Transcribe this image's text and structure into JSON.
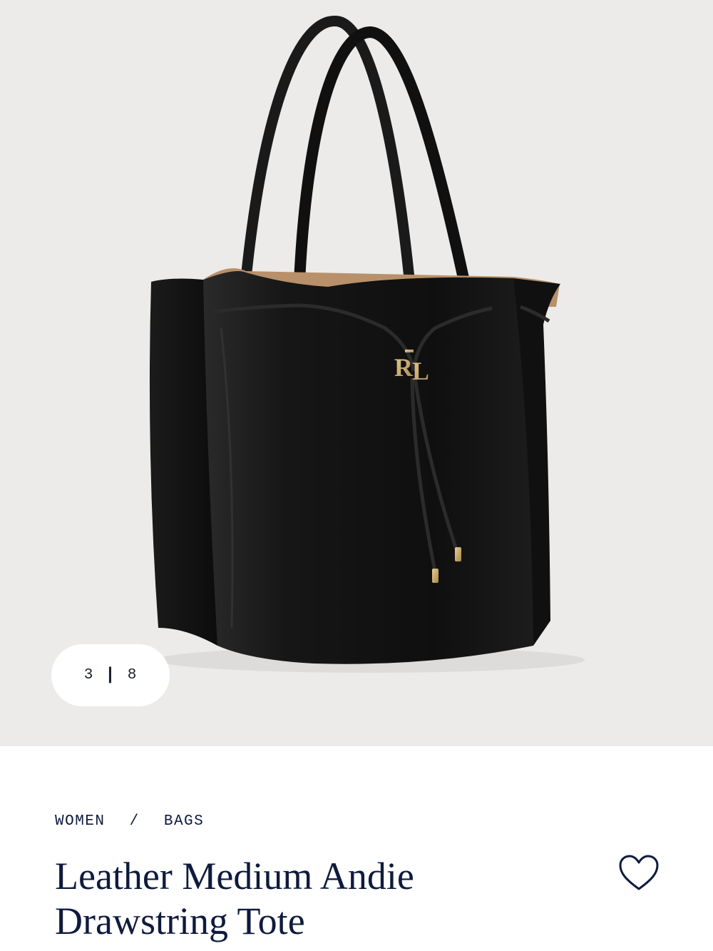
{
  "gallery": {
    "current": "3",
    "separator": "|",
    "total": "8",
    "background": "#ecebe9",
    "image_alt": "Black leather drawstring tote bag with gold RL logo"
  },
  "breadcrumb": {
    "items": [
      "WOMEN",
      "BAGS"
    ],
    "separator": "/"
  },
  "product": {
    "title_line1": "Leather Medium Andie",
    "title_line2": "Drawstring Tote"
  },
  "icons": {
    "favorite": "heart-outline-icon"
  },
  "colors": {
    "text_navy": "#0e1b3d",
    "bag_black": "#141414",
    "hardware_gold": "#c9a961",
    "lining_tan": "#b8906a"
  }
}
